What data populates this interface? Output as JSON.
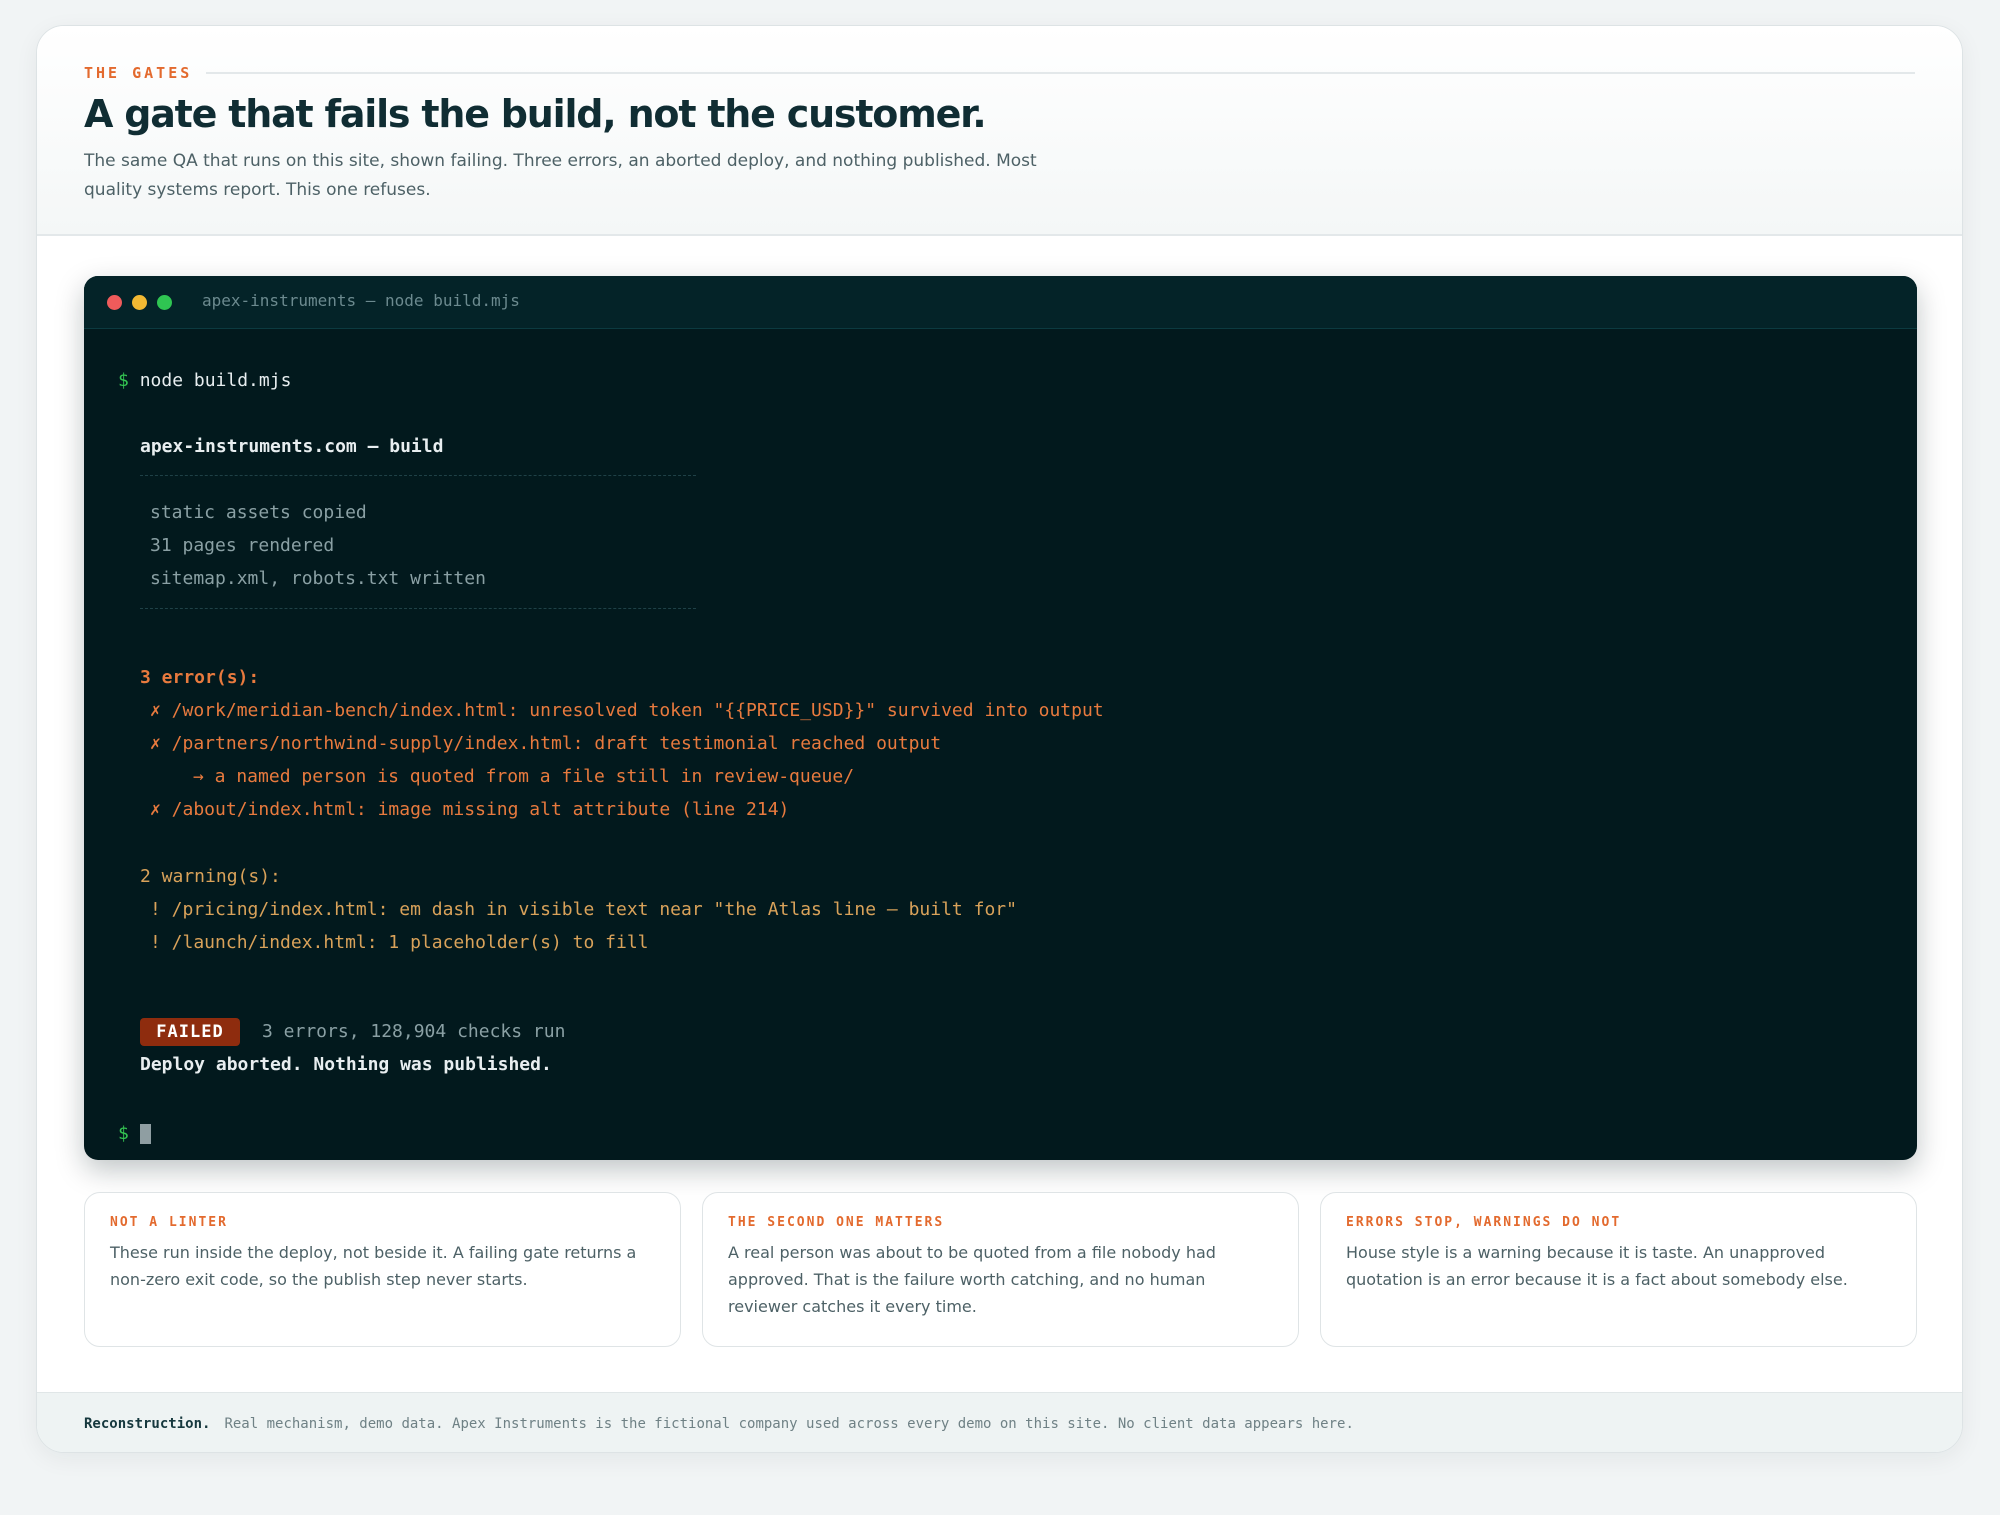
{
  "header": {
    "eyebrow": "THE GATES",
    "title": "A gate that fails the build, not the customer.",
    "subtitle": "The same QA that runs on this site, shown failing. Three errors, an aborted deploy, and nothing published. Most quality systems report. This one refuses."
  },
  "terminal": {
    "window_title": "apex-instruments — node build.mjs",
    "prompt_symbol": "$",
    "command": "node build.mjs",
    "build_title": "apex-instruments.com — build",
    "steps": [
      "static assets copied",
      "31 pages rendered",
      "sitemap.xml, robots.txt written"
    ],
    "errors_header": "3 error(s):",
    "errors": [
      "✗ /work/meridian-bench/index.html: unresolved token \"{{PRICE_USD}}\" survived into output",
      "✗ /partners/northwind-supply/index.html: draft testimonial reached output",
      "→ a named person is quoted from a file still in review-queue/",
      "✗ /about/index.html: image missing alt attribute (line 214)"
    ],
    "warnings_header": "2 warning(s):",
    "warnings": [
      "! /pricing/index.html: em dash in visible text near \"the Atlas line — built for\"",
      "! /launch/index.html: 1 placeholder(s) to fill"
    ],
    "status_badge": "FAILED",
    "status_summary": "3 errors, 128,904 checks run",
    "final_message": "Deploy aborted. Nothing was published."
  },
  "notes": [
    {
      "title": "NOT A LINTER",
      "body": "These run inside the deploy, not beside it. A failing gate returns a non-zero exit code, so the publish step never starts."
    },
    {
      "title": "THE SECOND ONE MATTERS",
      "body": "A real person was about to be quoted from a file nobody had approved. That is the failure worth catching, and no human reviewer catches it every time."
    },
    {
      "title": "ERRORS STOP, WARNINGS DO NOT",
      "body": "House style is a warning because it is taste. An unapproved quotation is an error because it is a fact about somebody else."
    }
  ],
  "footer": {
    "label": "Reconstruction.",
    "text": "Real mechanism, demo data. Apex Instruments is the fictional company used across every demo on this site. No client data appears here."
  },
  "colors": {
    "accent": "#e36a2e",
    "terminal_bg": "#02191d",
    "error": "#e87a3e",
    "warning": "#d9a25a",
    "prompt": "#34c552",
    "failed_badge": "#8e2c0e"
  }
}
